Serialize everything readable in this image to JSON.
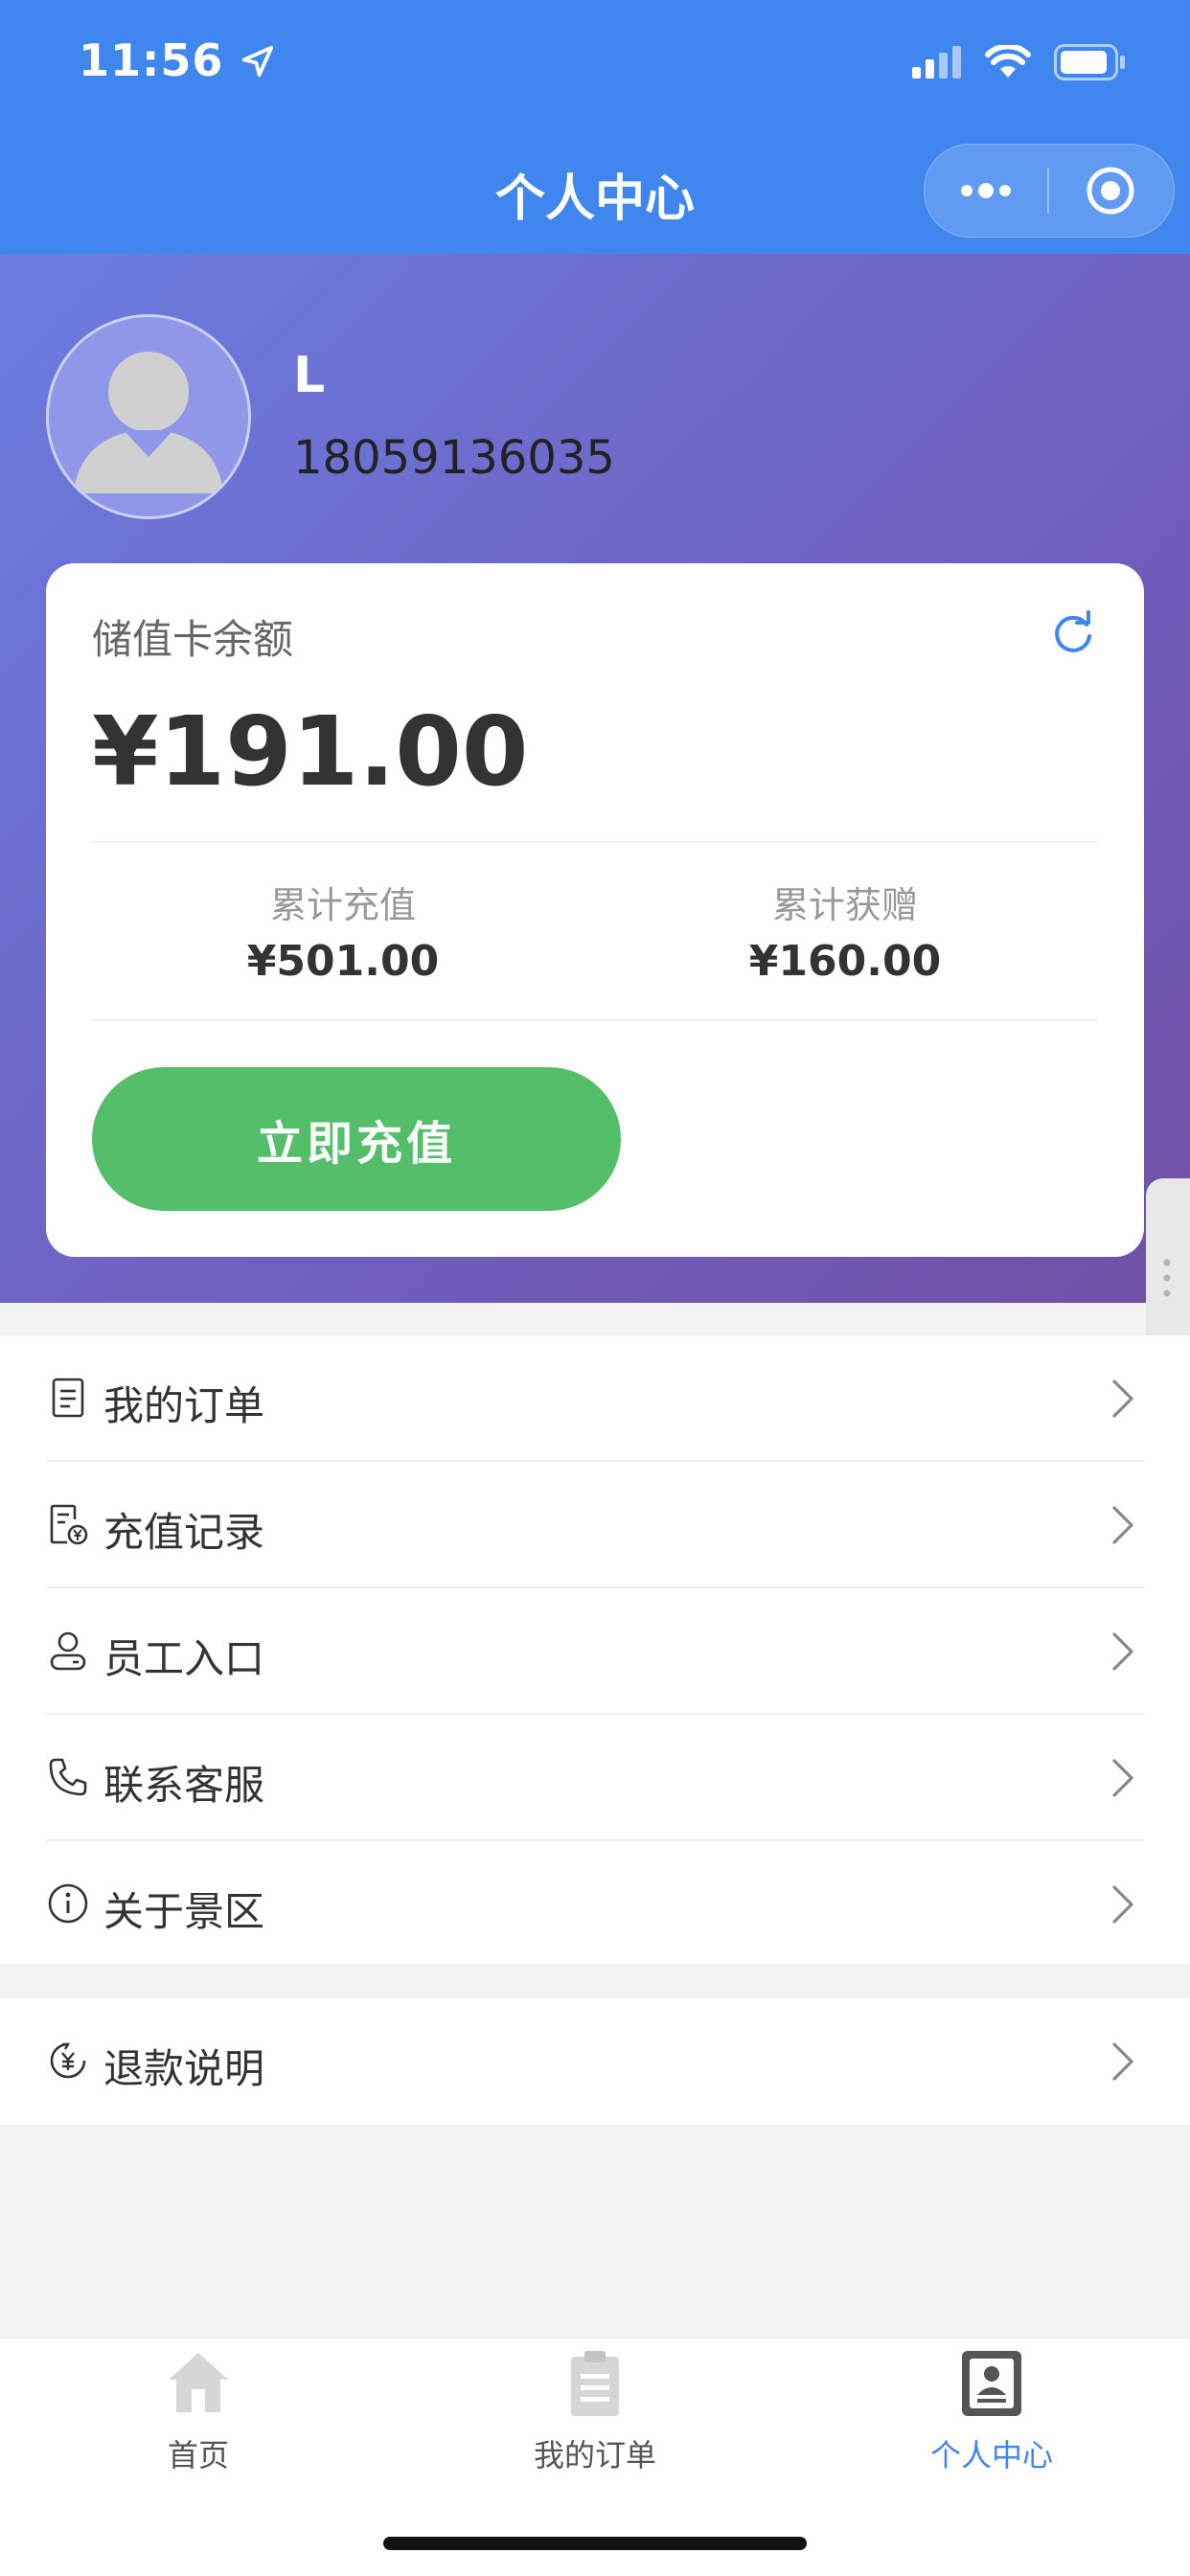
{
  "status": {
    "time": "11:56"
  },
  "nav": {
    "title": "个人中心"
  },
  "profile": {
    "name": "L",
    "phone": "18059136035"
  },
  "card": {
    "title": "储值卡余额",
    "balance": "¥191.00",
    "stats": [
      {
        "label": "累计充值",
        "value": "¥501.00"
      },
      {
        "label": "累计获赠",
        "value": "¥160.00"
      }
    ],
    "recharge_button": "立即充值"
  },
  "menu": [
    {
      "label": "我的订单",
      "icon": "document-icon"
    },
    {
      "label": "充值记录",
      "icon": "recharge-record-icon"
    },
    {
      "label": "员工入口",
      "icon": "staff-icon"
    },
    {
      "label": "联系客服",
      "icon": "phone-icon"
    },
    {
      "label": "关于景区",
      "icon": "info-icon"
    }
  ],
  "menu2": [
    {
      "label": "退款说明",
      "icon": "refund-icon"
    }
  ],
  "tabbar": [
    {
      "label": "首页",
      "icon": "home-icon",
      "active": false
    },
    {
      "label": "我的订单",
      "icon": "clipboard-icon",
      "active": false
    },
    {
      "label": "个人中心",
      "icon": "profile-card-icon",
      "active": true
    }
  ],
  "colors": {
    "primary": "#3f86ee",
    "accent_green": "#55be6a",
    "active_tab": "#3f86ee"
  }
}
